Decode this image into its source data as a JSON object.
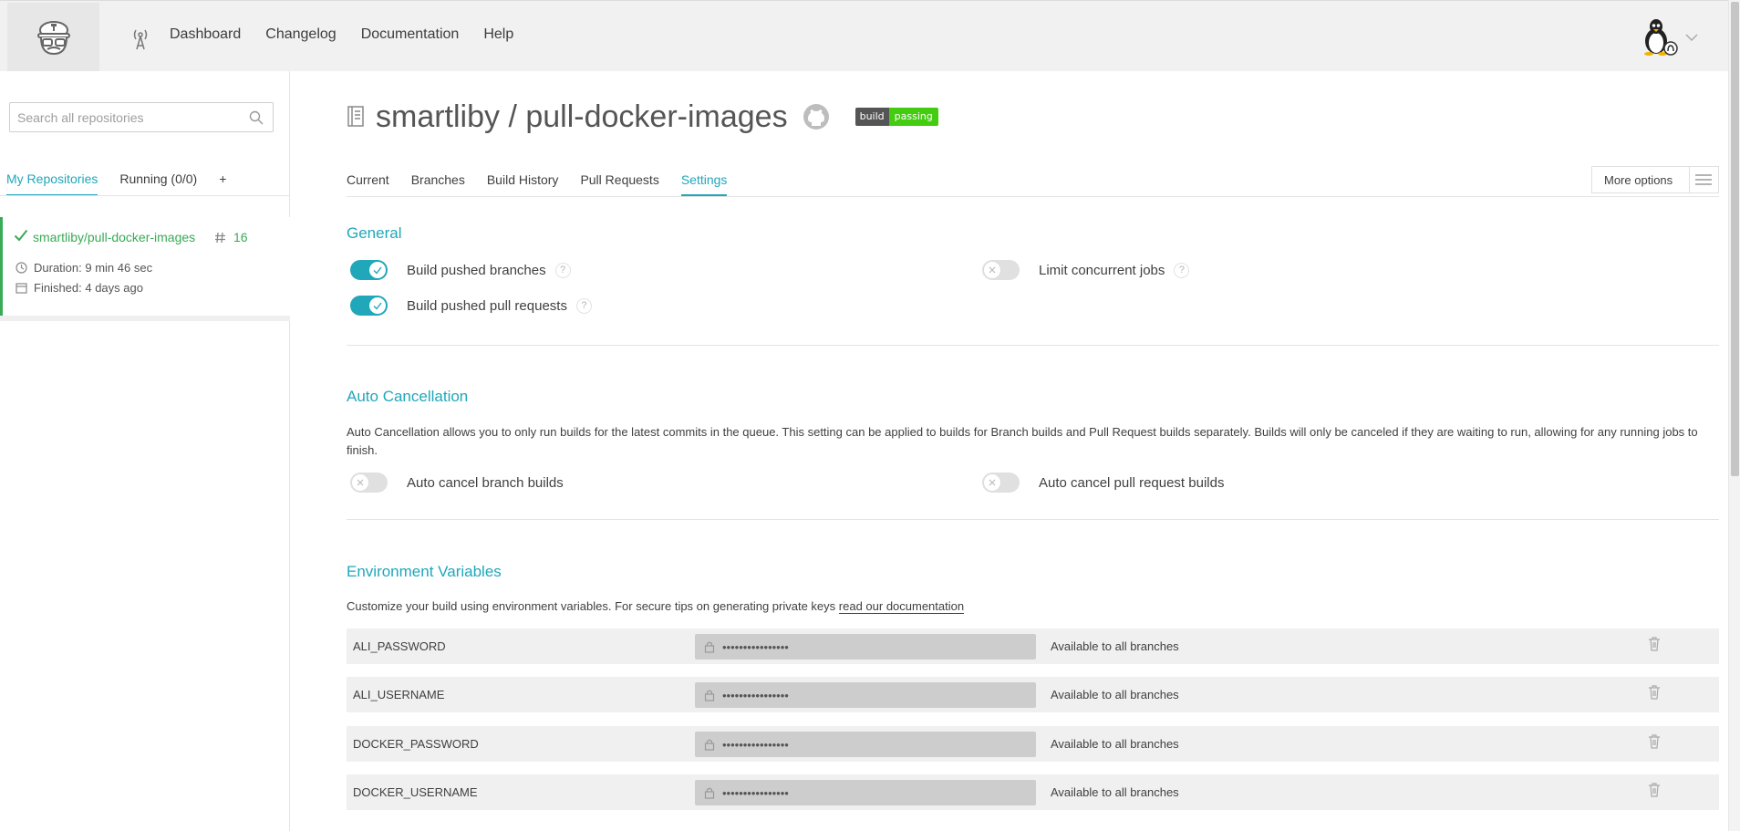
{
  "nav": {
    "items": [
      "Dashboard",
      "Changelog",
      "Documentation",
      "Help"
    ]
  },
  "sidebar": {
    "search_placeholder": "Search all repositories",
    "tabs": [
      "My Repositories",
      "Running (0/0)",
      "+"
    ],
    "repo": {
      "name": "smartliby/pull-docker-images",
      "build_number": "16",
      "duration": "Duration: 9 min 46 sec",
      "finished": "Finished: 4 days ago",
      "status_color": "#39aa56"
    }
  },
  "main": {
    "title": "smartliby / pull-docker-images",
    "badge": {
      "left": "build",
      "right": "passing"
    },
    "tabs": [
      "Current",
      "Branches",
      "Build History",
      "Pull Requests",
      "Settings"
    ],
    "more_options": "More options",
    "general": {
      "title": "General",
      "settings": [
        {
          "label": "Build pushed branches",
          "on": true
        },
        {
          "label": "Build pushed pull requests",
          "on": true
        },
        {
          "label": "Limit concurrent jobs",
          "on": false
        }
      ]
    },
    "auto_cancellation": {
      "title": "Auto Cancellation",
      "description": "Auto Cancellation allows you to only run builds for the latest commits in the queue. This setting can be applied to builds for Branch builds and Pull Request builds separately. Builds will only be canceled if they are waiting to run, allowing for any running jobs to finish.",
      "settings": [
        {
          "label": "Auto cancel branch builds",
          "on": false
        },
        {
          "label": "Auto cancel pull request builds",
          "on": false
        }
      ]
    },
    "env": {
      "title": "Environment Variables",
      "description": "Customize your build using environment variables. For secure tips on generating private keys",
      "link": "read our documentation",
      "rows": [
        {
          "name": "ALI_PASSWORD",
          "value": "••••••••••••••••",
          "branch": "Available to all branches"
        },
        {
          "name": "ALI_USERNAME",
          "value": "••••••••••••••••",
          "branch": "Available to all branches"
        },
        {
          "name": "DOCKER_PASSWORD",
          "value": "••••••••••••••••",
          "branch": "Available to all branches"
        },
        {
          "name": "DOCKER_USERNAME",
          "value": "••••••••••••••••",
          "branch": "Available to all branches"
        }
      ]
    }
  },
  "colors": {
    "accent": "#20a7ba",
    "success": "#39aa56",
    "badge_green": "#44cc11"
  },
  "icons": [
    "travis-mascot-icon",
    "antenna-icon",
    "linux-avatar-icon",
    "chevron-down-icon",
    "search-icon",
    "check-icon",
    "hash-icon",
    "clock-icon",
    "calendar-icon",
    "repo-book-icon",
    "github-icon",
    "hamburger-icon",
    "question-icon",
    "lock-icon",
    "trash-icon"
  ]
}
